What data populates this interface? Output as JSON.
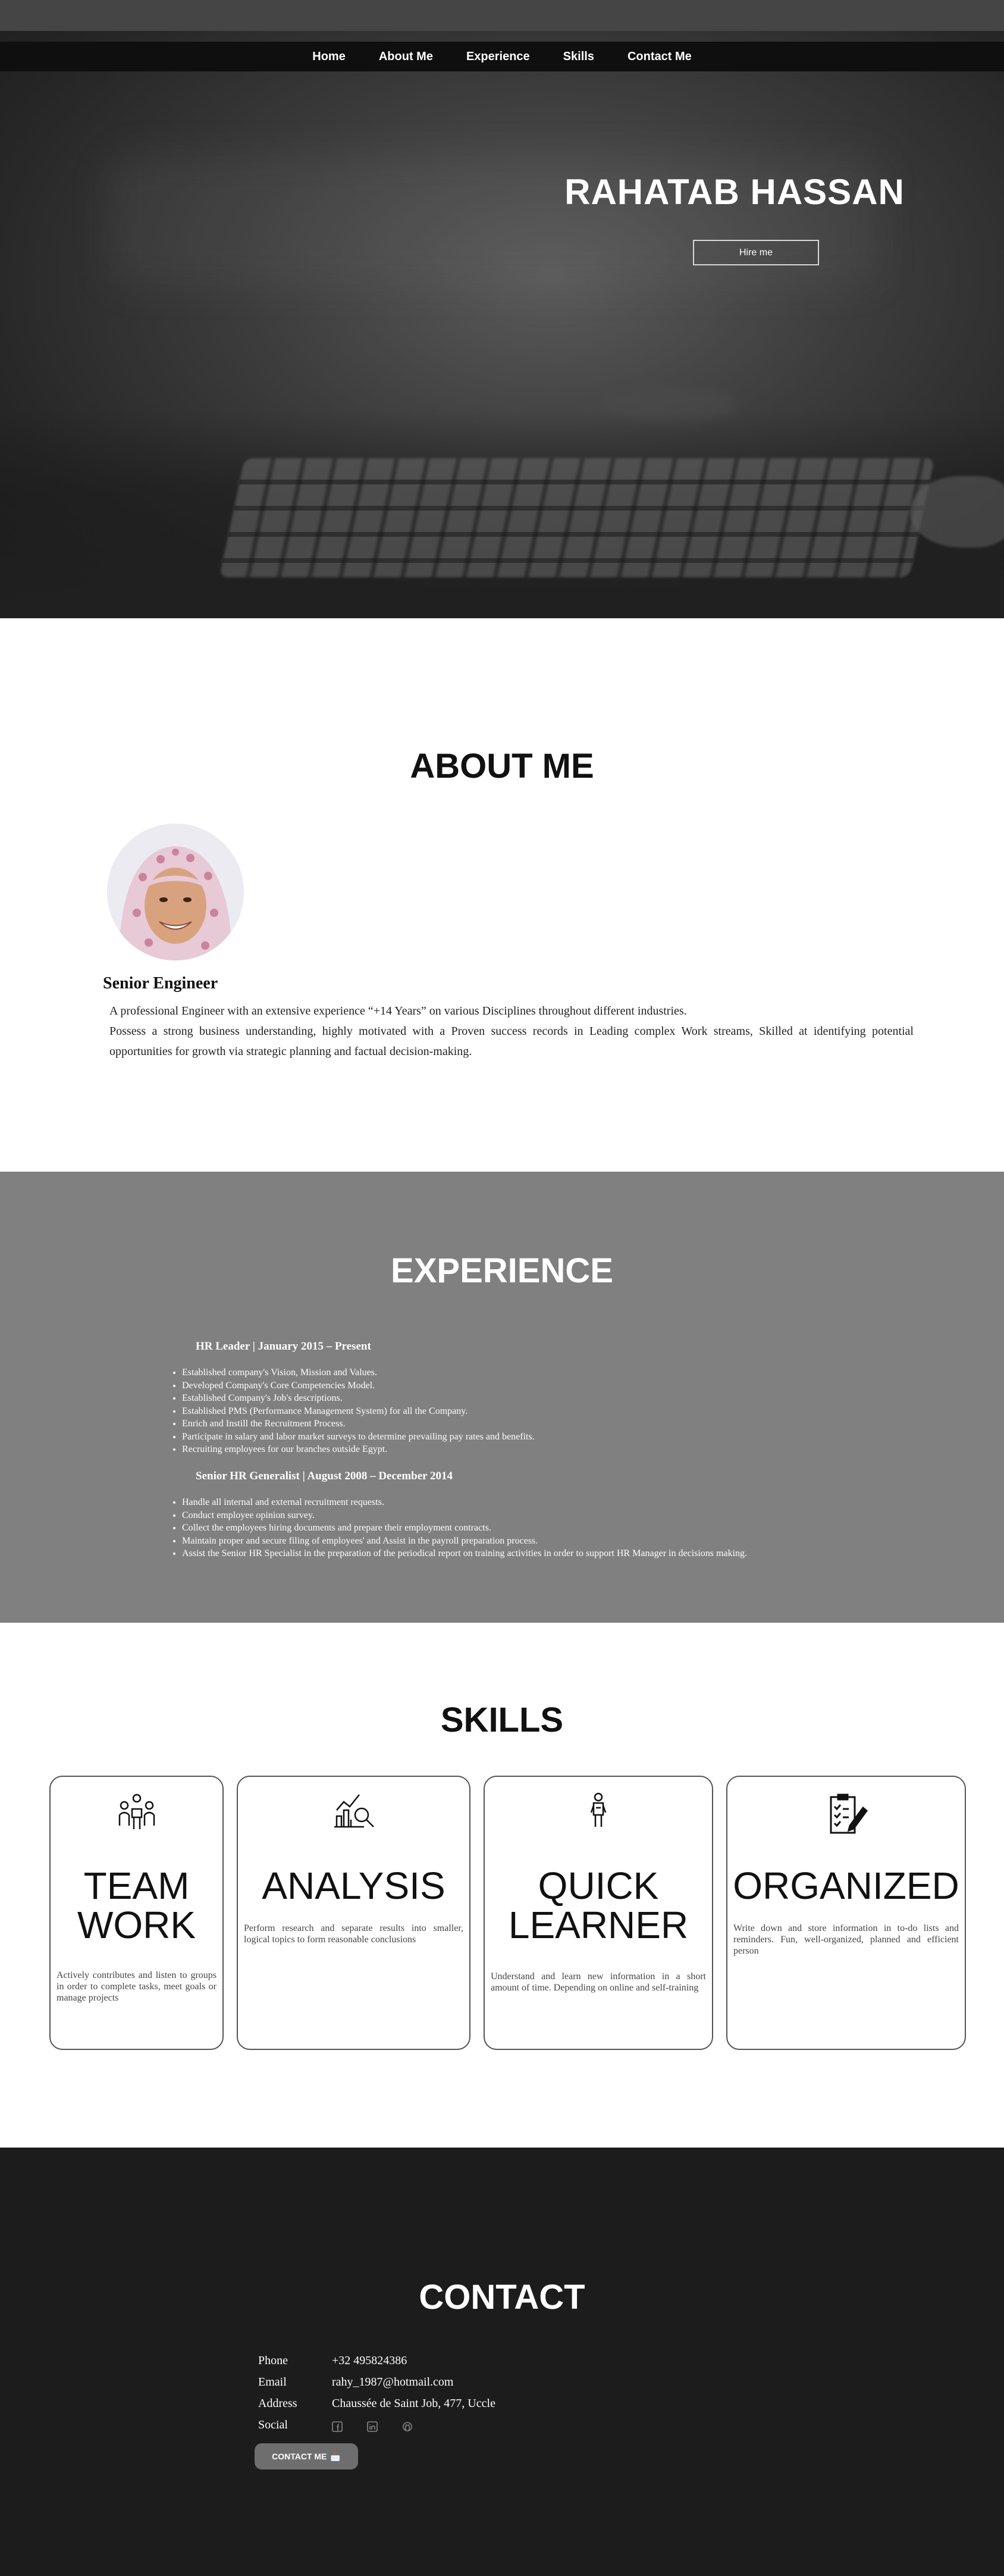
{
  "nav": {
    "items": [
      "Home",
      "About Me",
      "Experience",
      "Skills",
      "Contact Me"
    ]
  },
  "hero": {
    "name": "RAHATAB HASSAN",
    "hire_label": "Hire me"
  },
  "about": {
    "title": "ABOUT ME",
    "role": "Senior Engineer",
    "paragraphs": [
      "A professional Engineer with an extensive experience “+14 Years” on various Disciplines throughout different industries.",
      "Possess a strong business understanding, highly motivated with a Proven success records in Leading complex Work streams, Skilled at identifying potential opportunities for growth via strategic planning and factual decision-making."
    ]
  },
  "experience": {
    "title": "EXPERIENCE",
    "jobs": [
      {
        "title": "HR Leader | January 2015 – Present",
        "items": [
          "Established company's Vision, Mission and Values.",
          "Developed Company's Core Competencies Model.",
          "Established Company's Job's descriptions.",
          "Established PMS (Performance Management System) for all the Company.",
          "Enrich and Instill the Recruitment Process.",
          "Participate in salary and labor market surveys to determine prevailing pay rates and benefits.",
          "Recruiting employees for our branches outside Egypt."
        ]
      },
      {
        "title": "Senior HR Generalist | August 2008 – December 2014",
        "items": [
          "Handle all internal and external recruitment requests.",
          "Conduct employee opinion survey.",
          "Collect the employees hiring documents and prepare their employment contracts.",
          "Maintain proper and secure filing of employees' and Assist in the payroll preparation process.",
          "Assist the Senior HR Specialist in the preparation of the periodical report on training activities in order to support HR Manager in decisions making."
        ]
      }
    ]
  },
  "skills": {
    "title": "SKILLS",
    "cards": [
      {
        "icon": "team-icon",
        "title": "TEAM WORK",
        "desc": "Actively contributes and listen to groups in order to complete tasks, meet goals or manage projects"
      },
      {
        "icon": "analysis-icon",
        "title": "ANALYSIS",
        "desc": "Perform research and separate results into smaller, logical topics to form reasonable conclusions"
      },
      {
        "icon": "learner-icon",
        "title": "QUICK LEARNER",
        "desc": "Understand and learn new information in a short amount of time. Depending on online and self-training"
      },
      {
        "icon": "organized-icon",
        "title": "ORGANIZED",
        "desc": "Write down and store information in to-do lists and reminders. Fun, well-organized, planned and efficient person"
      }
    ]
  },
  "contact": {
    "title": "CONTACT",
    "phone_label": "Phone",
    "phone": "+32 495824386",
    "email_label": "Email",
    "email": "rahy_1987@hotmail.com",
    "address_label": "Address",
    "address": "Chaussée de Saint Job, 477, Uccle",
    "social_label": "Social",
    "social_icons": [
      "facebook-icon",
      "linkedin-icon",
      "github-icon"
    ],
    "button_label": "CONTACT ME",
    "button_emoji": "📩"
  }
}
